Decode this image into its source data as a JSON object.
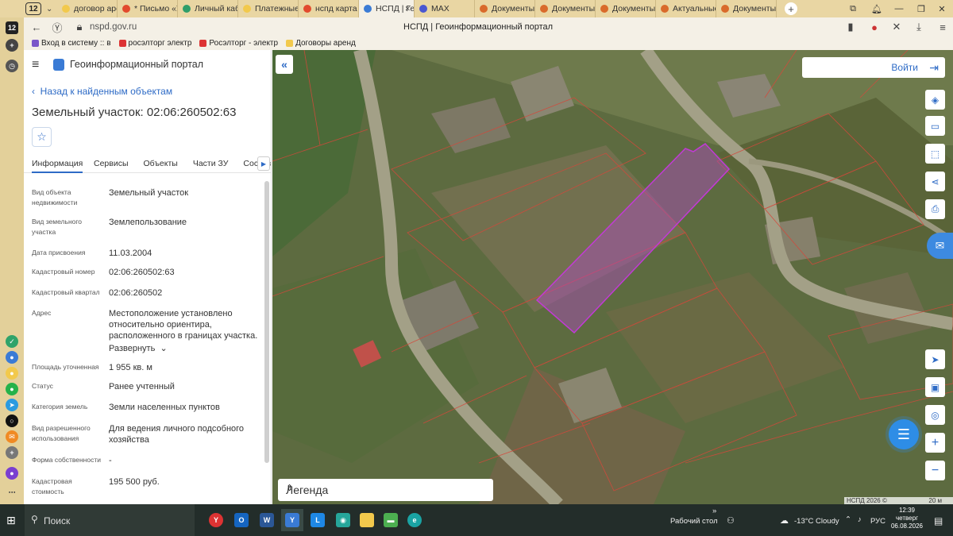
{
  "browser": {
    "tab_count": "12",
    "tabs": [
      {
        "label": "договор аре",
        "color": "#f2c94c"
      },
      {
        "label": "* Письмо «Ус",
        "color": "#e24a2d"
      },
      {
        "label": "Личный каби",
        "color": "#2f9e6a"
      },
      {
        "label": "Платежные д",
        "color": "#f2c94c"
      },
      {
        "label": "нспд карта п",
        "color": "#e24a2d"
      },
      {
        "label": "НСПД | Ге",
        "color": "#3a7bd5"
      },
      {
        "label": "MAX",
        "color": "#4a57d1"
      },
      {
        "label": "Документы н",
        "color": "#d96a2b"
      },
      {
        "label": "Документы н",
        "color": "#d96a2b"
      },
      {
        "label": "Документы н",
        "color": "#d96a2b"
      },
      {
        "label": "Актуальные",
        "color": "#d96a2b"
      },
      {
        "label": "Документы н",
        "color": "#d96a2b"
      }
    ],
    "url": "nspd.gov.ru",
    "page_title": "НСПД | Геоинформационный портал",
    "bookmarks": [
      {
        "label": "Вход в систему :: в",
        "color": "#7a57c9"
      },
      {
        "label": "росэлторг электр",
        "color": "#d33"
      },
      {
        "label": "Росэлторг - электр",
        "color": "#d33"
      },
      {
        "label": "Договоры аренд",
        "color": "#f2c94c"
      }
    ]
  },
  "panel": {
    "portal_title": "Геоинформационный портал",
    "back_link": "Назад к найденным объектам",
    "object_title": "Земельный участок: 02:06:260502:63",
    "tabs": [
      "Информация",
      "Сервисы",
      "Объекты",
      "Части ЗУ",
      "Состав"
    ],
    "expand_label": "Развернуть",
    "fields": [
      {
        "label": "Вид объекта недвижимости",
        "value": "Земельный участок"
      },
      {
        "label": "Вид земельного участка",
        "value": "Землепользование"
      },
      {
        "label": "Дата присвоения",
        "value": "11.03.2004"
      },
      {
        "label": "Кадастровый номер",
        "value": "02:06:260502:63"
      },
      {
        "label": "Кадастровый квартал",
        "value": "02:06:260502"
      },
      {
        "label": "Адрес",
        "value": "Местоположение установлено относительно ориентира, расположенного в границах участка."
      },
      {
        "label": "Площадь уточненная",
        "value": "1 955 кв. м"
      },
      {
        "label": "Статус",
        "value": "Ранее учтенный"
      },
      {
        "label": "Категория земель",
        "value": "Земли населенных пунктов"
      },
      {
        "label": "Вид разрешенного использования",
        "value": "Для ведения личного подсобного хозяйства"
      },
      {
        "label": "Форма собственности",
        "value": "-"
      },
      {
        "label": "Кадастровая стоимость",
        "value": "195 500 руб."
      }
    ]
  },
  "map": {
    "login_label": "Войти",
    "legend_label": "Легенда",
    "attribution": "НСПД 2026 ©",
    "scale": "20 м",
    "parcel_color": "#b04cc0"
  },
  "taskbar": {
    "search_label": "Поиск",
    "desktop_label": "Рабочий стол",
    "weather": "-13°C  Cloudy",
    "lang": "РУС",
    "time": "12:39",
    "day": "четверг",
    "date": "06.08.2026"
  }
}
